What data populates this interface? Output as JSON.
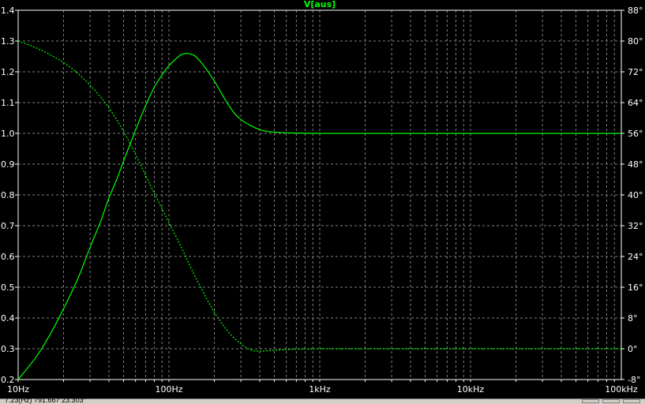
{
  "chart_data": {
    "type": "line",
    "title": "V[aus]",
    "xscale": "log",
    "xlim": [
      10,
      100000
    ],
    "ylim": [
      0.2,
      1.4
    ],
    "y2lim": [
      -8,
      88
    ],
    "x_tick_labels": [
      {
        "value": 10,
        "label": "10Hz"
      },
      {
        "value": 100,
        "label": "100Hz"
      },
      {
        "value": 1000,
        "label": "1kHz"
      },
      {
        "value": 10000,
        "label": "10kHz"
      },
      {
        "value": 100000,
        "label": "100kHz"
      }
    ],
    "y_tick_labels": [
      {
        "value": 0.2,
        "label": "0.2"
      },
      {
        "value": 0.3,
        "label": "0.3"
      },
      {
        "value": 0.4,
        "label": "0.4"
      },
      {
        "value": 0.5,
        "label": "0.5"
      },
      {
        "value": 0.6,
        "label": "0.6"
      },
      {
        "value": 0.7,
        "label": "0.7"
      },
      {
        "value": 0.8,
        "label": "0.8"
      },
      {
        "value": 0.9,
        "label": "0.9"
      },
      {
        "value": 1.0,
        "label": "1.0"
      },
      {
        "value": 1.1,
        "label": "1.1"
      },
      {
        "value": 1.2,
        "label": "1.2"
      },
      {
        "value": 1.3,
        "label": "1.3"
      },
      {
        "value": 1.4,
        "label": "1.4"
      }
    ],
    "y2_tick_labels": [
      {
        "value": -8,
        "label": "-8°"
      },
      {
        "value": 0,
        "label": "0°"
      },
      {
        "value": 8,
        "label": "8°"
      },
      {
        "value": 16,
        "label": "16°"
      },
      {
        "value": 24,
        "label": "24°"
      },
      {
        "value": 32,
        "label": "32°"
      },
      {
        "value": 40,
        "label": "40°"
      },
      {
        "value": 48,
        "label": "48°"
      },
      {
        "value": 56,
        "label": "56°"
      },
      {
        "value": 64,
        "label": "64°"
      },
      {
        "value": 72,
        "label": "72°"
      },
      {
        "value": 80,
        "label": "80°"
      },
      {
        "value": 88,
        "label": "88°"
      }
    ],
    "grid": true,
    "colors": {
      "background": "#000000",
      "grid": "#808080",
      "frame": "#ffffff",
      "trace": "#00ff00",
      "text": "#ffffff"
    },
    "series": [
      {
        "axis": "left",
        "style": "solid",
        "x": [
          10,
          13,
          16,
          20,
          25,
          30,
          35,
          40,
          45,
          50,
          60,
          70,
          80,
          90,
          100,
          110,
          120,
          130,
          140,
          150,
          170,
          200,
          250,
          300,
          400,
          500,
          700,
          1000,
          2000,
          5000,
          10000,
          100000
        ],
        "y": [
          0.2,
          0.27,
          0.34,
          0.43,
          0.53,
          0.63,
          0.71,
          0.79,
          0.85,
          0.91,
          1.01,
          1.09,
          1.15,
          1.19,
          1.22,
          1.24,
          1.255,
          1.26,
          1.257,
          1.25,
          1.22,
          1.17,
          1.09,
          1.045,
          1.012,
          1.004,
          1.001,
          1.0,
          1.0,
          1.0,
          1.0,
          1.0
        ]
      },
      {
        "axis": "right",
        "style": "dotted",
        "x": [
          10,
          13,
          16,
          20,
          25,
          30,
          35,
          40,
          45,
          50,
          60,
          70,
          80,
          90,
          100,
          120,
          150,
          200,
          250,
          300,
          350,
          400,
          500,
          700,
          1000,
          2000,
          10000,
          100000
        ],
        "y": [
          80,
          78.3,
          76.6,
          74.4,
          71.5,
          68.5,
          65.6,
          62.6,
          59.5,
          56.5,
          50.6,
          45.1,
          40.4,
          36.4,
          32.8,
          26.6,
          18.6,
          9.5,
          4.2,
          1.3,
          -0.3,
          -0.6,
          -0.4,
          -0.1,
          0,
          0,
          0,
          0
        ]
      }
    ]
  },
  "status": {
    "readout": "7.23(Hz)      791.667    23.303°"
  }
}
